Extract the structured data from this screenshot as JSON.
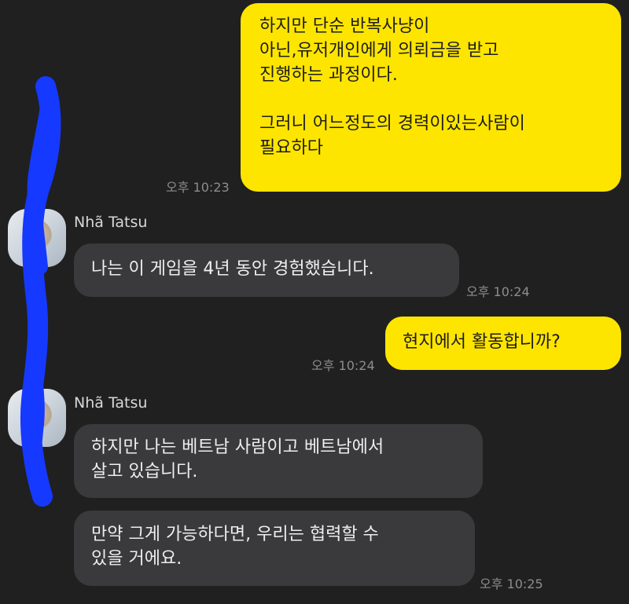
{
  "colors": {
    "background": "#202020",
    "my_bubble": "#fee500",
    "their_bubble": "#3a3a3c",
    "timestamp": "#8d8d8d",
    "redaction": "#1639ff"
  },
  "messages": [
    {
      "sender": "me",
      "text": "하지만 단순 반복사냥이\n아닌,유저개인에게 의뢰금을 받고\n진행하는 과정이다.\n\n그러니 어느정도의 경력이있는사람이\n필요하다",
      "time": "오후 10:23"
    },
    {
      "sender": "them",
      "name": "Nhã Tatsu",
      "text": "나는 이 게임을 4년 동안 경험했습니다.",
      "time": "오후 10:24"
    },
    {
      "sender": "me",
      "text": "현지에서 활동합니까?",
      "time": "오후 10:24"
    },
    {
      "sender": "them",
      "name": "Nhã Tatsu",
      "text": "하지만 나는 베트남 사람이고 베트남에서\n살고 있습니다."
    },
    {
      "sender": "them",
      "text": "만약 그게 가능하다면, 우리는 협력할 수\n있을 거에요.",
      "time": "오후 10:25"
    }
  ],
  "avatar_icon": "profile-photo"
}
